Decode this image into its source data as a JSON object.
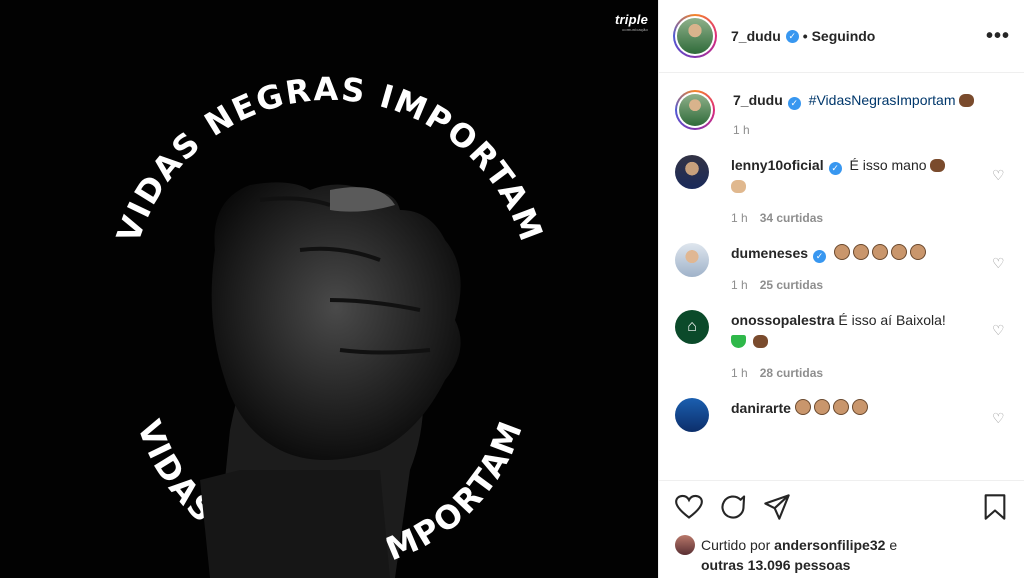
{
  "post": {
    "image": {
      "top_text": "VIDAS NEGRAS IMPORTAM",
      "bottom_text": "VIDAS NEGRAS IMPORTAM",
      "logo_text": "triple",
      "logo_sub": "comunicação"
    }
  },
  "header": {
    "username": "7_dudu",
    "follow_status": "• Seguindo",
    "more_label": "•••"
  },
  "caption": {
    "username": "7_dudu",
    "text": "#VidasNegrasImportam",
    "time": "1 h"
  },
  "comments": [
    {
      "username": "lenny10oficial",
      "verified": true,
      "text": "É isso mano",
      "time": "1 h",
      "likes": "34 curtidas"
    },
    {
      "username": "dumeneses",
      "verified": true,
      "text": "",
      "time": "1 h",
      "likes": "25 curtidas"
    },
    {
      "username": "onossopalestra",
      "verified": false,
      "text": "É isso aí Baixola!",
      "time": "1 h",
      "likes": "28 curtidas"
    },
    {
      "username": "danirarte",
      "verified": false,
      "text": "",
      "time": "",
      "likes": ""
    }
  ],
  "likes": {
    "prefix": "Curtido por",
    "user": "andersonfilipe32",
    "suffix": "e",
    "others": "outras 13.096 pessoas"
  }
}
